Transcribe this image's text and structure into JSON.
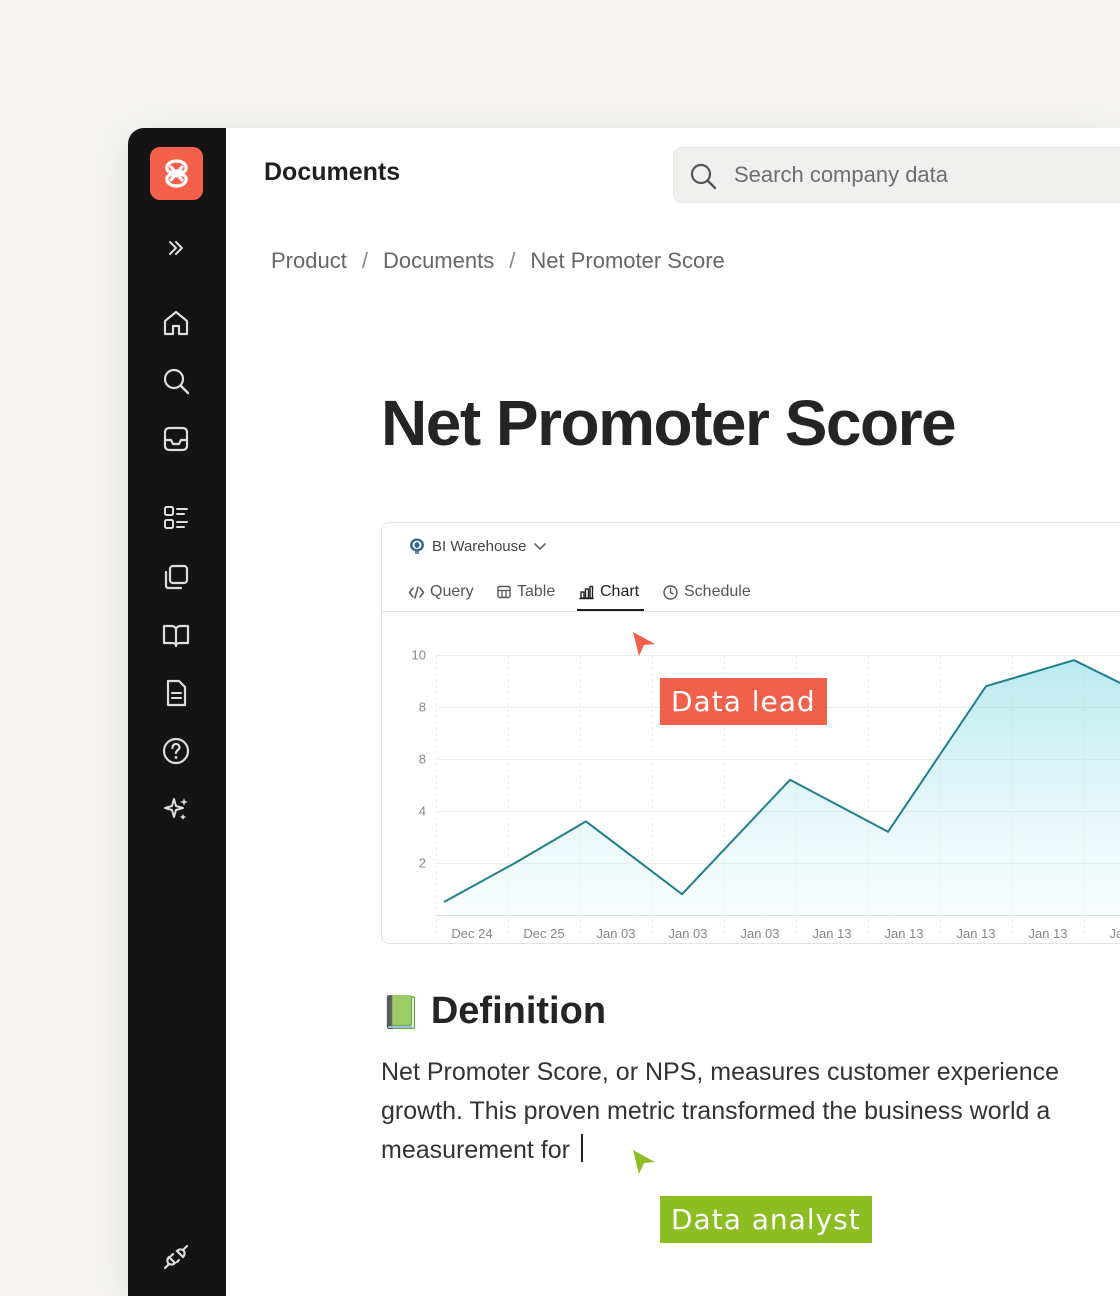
{
  "header": {
    "title": "Documents"
  },
  "search": {
    "placeholder": "Search company data"
  },
  "breadcrumb": [
    "Product",
    "Documents",
    "Net Promoter Score"
  ],
  "page": {
    "title": "Net Promoter Score"
  },
  "query_card": {
    "source": "BI Warehouse",
    "tabs": [
      "Query",
      "Table",
      "Chart",
      "Schedule"
    ],
    "active_tab": "Chart"
  },
  "chart_data": {
    "type": "area",
    "categories": [
      "Dec 24",
      "Dec 25",
      "Jan 03",
      "Jan 03",
      "Jan 03",
      "Jan 13",
      "Jan 13",
      "Jan 13",
      "Jan 13",
      "Jan"
    ],
    "y_tick_labels": [
      "10",
      "8",
      "8",
      "4",
      "2"
    ],
    "values": [
      0.5,
      2.0,
      3.6,
      0.8,
      5.2,
      3.2,
      8.8,
      9.8,
      8.7
    ],
    "ylim": [
      0,
      10
    ],
    "grid": true,
    "line_color": "#1f7f8c",
    "fill_color": "#7fd8e3"
  },
  "definition": {
    "emoji": "📗",
    "heading": "Definition",
    "lines": [
      "Net Promoter Score, or NPS, measures customer experience",
      "growth. This proven metric transformed the business world a",
      "measurement for "
    ]
  },
  "collaborators": [
    {
      "name": "Data lead",
      "color": "#f1604b"
    },
    {
      "name": "Data analyst",
      "color": "#8cbd22"
    }
  ],
  "colors": {
    "brand": "#f4604a",
    "sidebar": "#141414"
  }
}
